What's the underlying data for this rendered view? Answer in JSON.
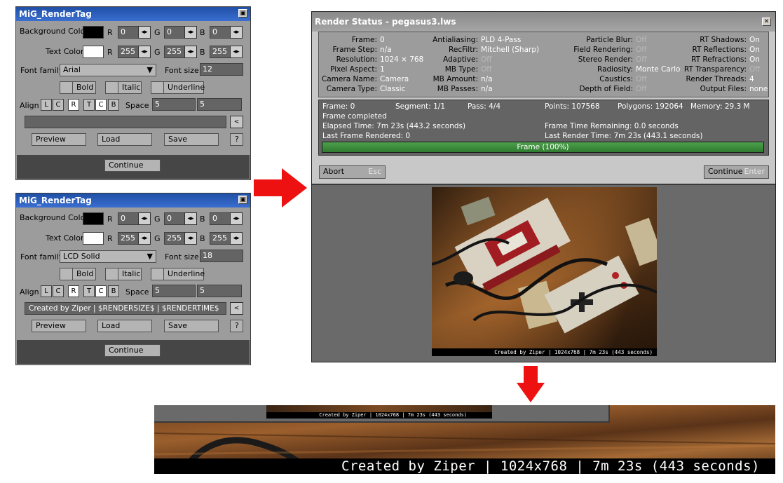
{
  "panel_a": {
    "title": "MiG_RenderTag",
    "bg_label": "Background Color",
    "text_label": "Text Color",
    "r": "R",
    "g": "G",
    "b": "B",
    "bg_r": "0",
    "bg_g": "0",
    "bg_b": "0",
    "tx_r": "255",
    "tx_g": "255",
    "tx_b": "255",
    "font_family_label": "Font family",
    "font_family": "Arial",
    "font_size_label": "Font size",
    "font_size": "12",
    "bold": "Bold",
    "italic": "Italic",
    "underline": "Underline",
    "align_label": "Align",
    "align": [
      "L",
      "C",
      "R",
      "T",
      "C",
      "B"
    ],
    "space_label": "Space",
    "space_a": "5",
    "space_b": "5",
    "text_value": "",
    "back": "<",
    "preview": "Preview",
    "load": "Load",
    "save": "Save",
    "help": "?",
    "continue": "Continue"
  },
  "panel_b": {
    "title": "MiG_RenderTag",
    "bg_label": "Background Color",
    "text_label": "Text Color",
    "r": "R",
    "g": "G",
    "b": "B",
    "bg_r": "0",
    "bg_g": "0",
    "bg_b": "0",
    "tx_r": "255",
    "tx_g": "255",
    "tx_b": "255",
    "font_family_label": "Font family",
    "font_family": "LCD Solid",
    "font_size_label": "Font size",
    "font_size": "18",
    "bold": "Bold",
    "italic": "Italic",
    "underline": "Underline",
    "align_label": "Align",
    "align": [
      "L",
      "C",
      "R",
      "T",
      "C",
      "B"
    ],
    "space_label": "Space",
    "space_a": "5",
    "space_b": "5",
    "text_value": "Created by Ziper | $RENDERSIZE$ | $RENDERTIME$",
    "back": "<",
    "preview": "Preview",
    "load": "Load",
    "save": "Save",
    "help": "?",
    "continue": "Continue"
  },
  "render": {
    "title": "Render Status - pegasus3.lws",
    "info": [
      {
        "k": "Frame:",
        "v": "0"
      },
      {
        "k": "Frame Step:",
        "v": "n/a"
      },
      {
        "k": "Resolution:",
        "v": "1024 × 768"
      },
      {
        "k": "Pixel Aspect:",
        "v": "1"
      },
      {
        "k": "Camera Name:",
        "v": "Camera"
      },
      {
        "k": "Camera Type:",
        "v": "Classic"
      },
      {
        "k": "Antialiasing:",
        "v": "PLD  4-Pass"
      },
      {
        "k": "RecFiltr:",
        "v": "Mitchell (Sharp)"
      },
      {
        "k": "Adaptive:",
        "v": "Off"
      },
      {
        "k": "MB Type:",
        "v": "Off"
      },
      {
        "k": "MB Amount:",
        "v": "n/a"
      },
      {
        "k": "MB Passes:",
        "v": "n/a"
      },
      {
        "k": "Particle Blur:",
        "v": "Off"
      },
      {
        "k": "Field Rendering:",
        "v": "Off"
      },
      {
        "k": "Stereo Render:",
        "v": "Off"
      },
      {
        "k": "Radiosity:",
        "v": "Monte Carlo"
      },
      {
        "k": "Caustics:",
        "v": "Off"
      },
      {
        "k": "Depth of Field:",
        "v": "Off"
      },
      {
        "k": "RT Shadows:",
        "v": "On"
      },
      {
        "k": "RT Reflections:",
        "v": "On"
      },
      {
        "k": "RT Refractions:",
        "v": "On"
      },
      {
        "k": "RT Transparency:",
        "v": "Off"
      },
      {
        "k": "Render Threads:",
        "v": "4"
      },
      {
        "k": "Output Files:",
        "v": "none"
      }
    ],
    "frame": "Frame: 0",
    "segment": "Segment: 1/1",
    "pass": "Pass: 4/4",
    "points": "Points: 107568",
    "polygons": "Polygons: 192064",
    "memory": "Memory: 29.3 M",
    "completed": "Frame completed",
    "elapsed": "Elapsed Time: 7m 23s (443.2 seconds)",
    "last_frame": "Last Frame Rendered: 0",
    "remaining": "Frame Time Remaining: 0.0 seconds",
    "last_time": "Last Render Time: 7m 23s (443.1 seconds)",
    "progress_label": "Frame (100%)",
    "progress": 1.0,
    "abort": "Abort",
    "abort_key": "Esc",
    "continue": "Continue",
    "continue_key": "Enter",
    "caption": "Created by Ziper | 1024x768 | 7m 23s (443 seconds)"
  },
  "zoom": {
    "caption_small": "Created by Ziper | 1024x768 | 7m 23s (443 seconds)",
    "caption_large": "Created by Ziper | 1024x768 | 7m 23s (443 seconds)"
  },
  "colors": {
    "arrow": "#ee1111",
    "titlebar": "#2a5cc0",
    "progress": "#3f8a3f"
  }
}
